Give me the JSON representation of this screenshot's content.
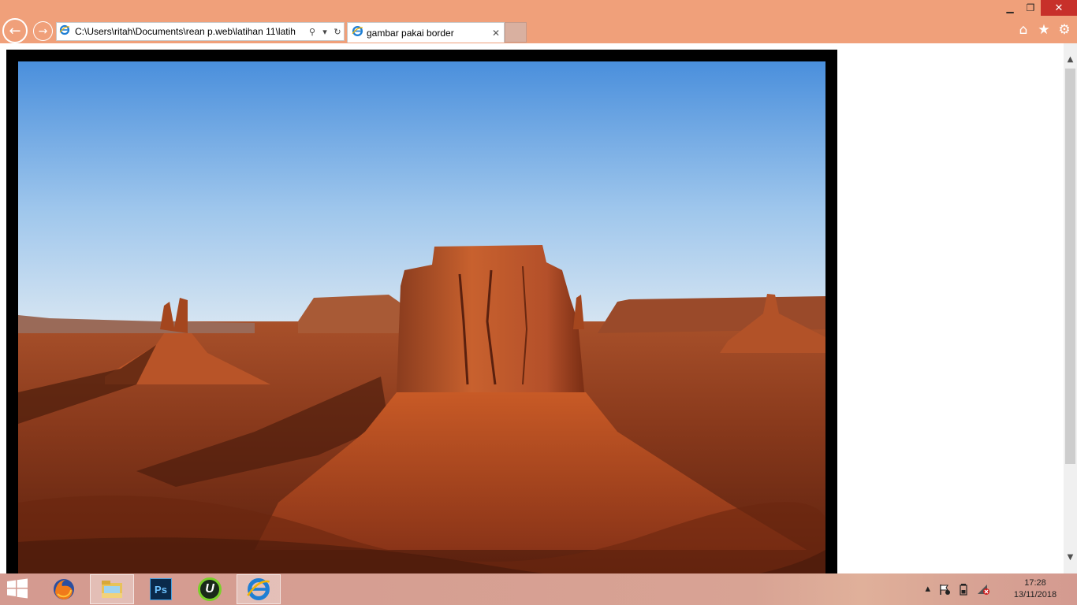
{
  "window": {
    "minimize_icon": "minimize-icon",
    "restore_icon": "restore-icon",
    "close_icon": "close-icon",
    "minimize_glyph": "▁",
    "restore_glyph": "❐",
    "close_glyph": "✕"
  },
  "nav": {
    "back_glyph": "←",
    "forward_glyph": "→"
  },
  "address": {
    "url": "C:\\Users\\ritah\\Documents\\rean p.web\\latihan 11\\latih",
    "page_icon": "ie-page-icon",
    "search_glyph": "⚲",
    "dropdown_glyph": "▾",
    "refresh_glyph": "↻"
  },
  "tab": {
    "title": "gambar pakai border",
    "close_glyph": "✕"
  },
  "toolbar": {
    "home_glyph": "⌂",
    "favorites_glyph": "★",
    "settings_glyph": "⚙"
  },
  "content": {
    "image_description_icon": "desert-photo",
    "border_color": "#000000"
  },
  "scrollbar": {
    "up_glyph": "▲",
    "down_glyph": "▼"
  },
  "taskbar": {
    "apps": [
      "start",
      "firefox",
      "file-explorer",
      "photoshop",
      "utorrent",
      "internet-explorer"
    ],
    "photoshop_label": "Ps",
    "utorrent_label": "U",
    "tray_up_glyph": "▴",
    "time": "17:28",
    "date": "13/11/2018"
  },
  "colors": {
    "chrome": "#f0a07a",
    "close_button": "#c7302a",
    "ie_blue": "#1f7fd4",
    "taskbar": "#d49a90"
  }
}
